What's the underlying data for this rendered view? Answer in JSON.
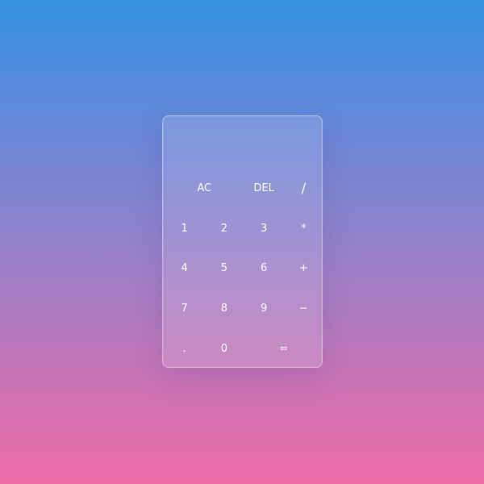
{
  "calculator": {
    "display": "",
    "keys": [
      {
        "label": "AC",
        "name": "all-clear-button"
      },
      {
        "label": "DEL",
        "name": "delete-button"
      },
      {
        "label": "/",
        "name": "divide-button"
      },
      {
        "label": "1",
        "name": "digit-1-button"
      },
      {
        "label": "2",
        "name": "digit-2-button"
      },
      {
        "label": "3",
        "name": "digit-3-button"
      },
      {
        "label": "*",
        "name": "multiply-button"
      },
      {
        "label": "4",
        "name": "digit-4-button"
      },
      {
        "label": "5",
        "name": "digit-5-button"
      },
      {
        "label": "6",
        "name": "digit-6-button"
      },
      {
        "label": "+",
        "name": "add-button"
      },
      {
        "label": "7",
        "name": "digit-7-button"
      },
      {
        "label": "8",
        "name": "digit-8-button"
      },
      {
        "label": "9",
        "name": "digit-9-button"
      },
      {
        "label": "−",
        "name": "subtract-button"
      },
      {
        "label": ".",
        "name": "decimal-point-button"
      },
      {
        "label": "0",
        "name": "digit-0-button"
      },
      {
        "label": "=",
        "name": "equals-button"
      }
    ]
  },
  "colors": {
    "background_top": "#3592E3",
    "background_bottom": "#EC6CA6",
    "text": "#ffffff"
  }
}
